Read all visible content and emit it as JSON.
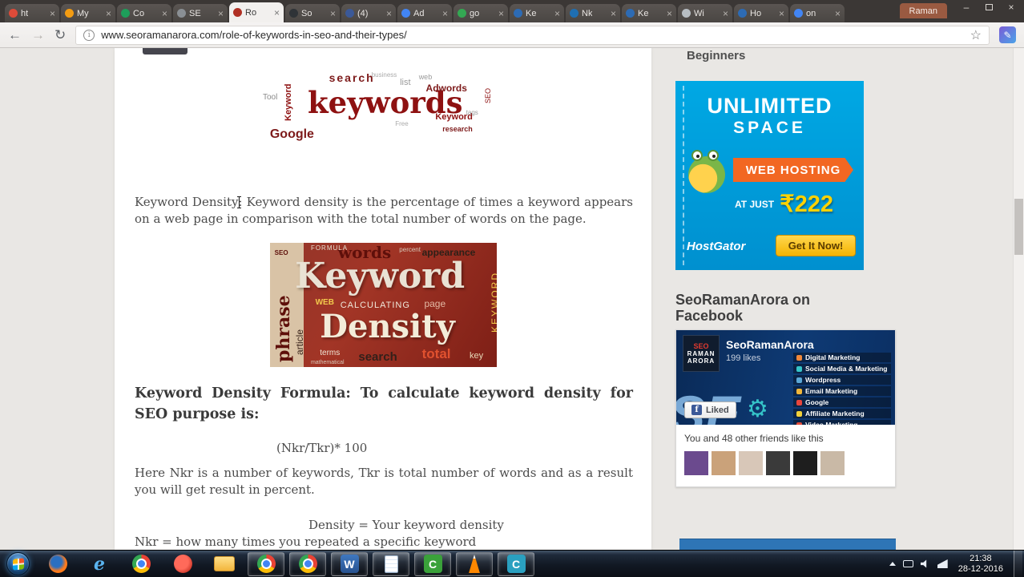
{
  "browser": {
    "tabs": [
      {
        "label": "ht",
        "fav": "#dd4b39"
      },
      {
        "label": "My",
        "fav": "#f39c12"
      },
      {
        "label": "Co",
        "fav": "#1e9e5a"
      },
      {
        "label": "SE",
        "fav": "#8a8f94"
      },
      {
        "label": "Ro",
        "fav": "#b03024",
        "cls": "active"
      },
      {
        "label": "So",
        "fav": "#2f3337"
      },
      {
        "label": "(4)",
        "fav": "#3b5998"
      },
      {
        "label": "Ad",
        "fav": "#4285f4"
      },
      {
        "label": "go",
        "fav": "#34a853"
      },
      {
        "label": "Ke",
        "fav": "#2d6bb4"
      },
      {
        "label": "Nk",
        "fav": "#1f6fb2"
      },
      {
        "label": "Ke",
        "fav": "#2d6bb4"
      },
      {
        "label": "Wi",
        "fav": "#b7bdc2"
      },
      {
        "label": "Ho",
        "fav": "#2d6bb4"
      },
      {
        "label": "on",
        "fav": "#4285f4"
      }
    ],
    "tab_close": "×",
    "profile_name": "Raman",
    "controls": {
      "minimize": "–",
      "close": "×"
    },
    "nav": {
      "back": "←",
      "forward": "→",
      "reload": "↻"
    },
    "info_glyph": "i",
    "url": "www.seoramanarora.com/role-of-keywords-in-seo-and-their-types/",
    "star_glyph": "☆",
    "extension_glyph": "✎"
  },
  "article": {
    "p1_label": "Keyword Density:",
    "p1_text": " Keyword density is the percentage of times a keyword appears on a web page in comparison with the total number of words on the page.",
    "formula_heading": "Keyword Density Formula:  To calculate keyword density for SEO purpose is:",
    "formula": "(Nkr/Tkr)* 100",
    "p2": "Here Nkr is a number of keywords, Tkr is total number of words and as a result you will get result in percent.",
    "line_density": "Density = Your keyword density",
    "line_nkr": "Nkr = how many times you repeated a specific keyword"
  },
  "cloud1": {
    "words": [
      {
        "t": "search",
        "cls": "a1"
      },
      {
        "t": "keywords",
        "cls": "a2"
      },
      {
        "t": "Google",
        "cls": "a3"
      },
      {
        "t": "Keyword",
        "cls": "a4"
      },
      {
        "t": "Tool",
        "cls": "a5"
      },
      {
        "t": "list",
        "cls": "a6"
      },
      {
        "t": "business",
        "cls": "a7"
      },
      {
        "t": "Adwords",
        "cls": "a8"
      },
      {
        "t": "web",
        "cls": "a9"
      },
      {
        "t": "Keyword",
        "cls": "a10"
      },
      {
        "t": "Free",
        "cls": "a11"
      },
      {
        "t": "SEO",
        "cls": "a12"
      },
      {
        "t": "tags",
        "cls": "a13"
      },
      {
        "t": "research",
        "cls": "a14"
      }
    ]
  },
  "cloud2": {
    "words": [
      {
        "t": "FORMULA",
        "cls": "b1"
      },
      {
        "t": "words",
        "cls": "b2"
      },
      {
        "t": "percent",
        "cls": "b3"
      },
      {
        "t": "appearance",
        "cls": "b4"
      },
      {
        "t": "Keyword",
        "cls": "b5"
      },
      {
        "t": "WEB",
        "cls": "b6"
      },
      {
        "t": "CALCULATING",
        "cls": "b7"
      },
      {
        "t": "page",
        "cls": "b8"
      },
      {
        "t": "phrase",
        "cls": "b9"
      },
      {
        "t": "article",
        "cls": "b10"
      },
      {
        "t": "Density",
        "cls": "b11"
      },
      {
        "t": "terms",
        "cls": "b12"
      },
      {
        "t": "search",
        "cls": "b13"
      },
      {
        "t": "total",
        "cls": "b14"
      },
      {
        "t": "KEYWORD",
        "cls": "b15"
      },
      {
        "t": "key",
        "cls": "b16"
      },
      {
        "t": "SEO",
        "cls": "b17"
      },
      {
        "t": "mathematical",
        "cls": "b18"
      }
    ]
  },
  "sidebar": {
    "partial_heading": "Beginners",
    "ad": {
      "line1": "UNLIMITED",
      "line2": "SPACE",
      "ribbon": "WEB HOSTING",
      "at_just": "AT JUST",
      "price": "₹222",
      "brand": "HostGator",
      "cta": "Get It Now!"
    },
    "fb_heading": "SeoRamanArora on Facebook",
    "facebook": {
      "logo_lines": {
        "l1": "SEO",
        "l2": "RAMAN",
        "l3": "ARORA"
      },
      "name": "SeoRamanArora",
      "likes": "199 likes",
      "cover_text": "SE",
      "gear_glyph": "⚙",
      "items": [
        {
          "label": "Digital Marketing",
          "ic": "#f0883a"
        },
        {
          "label": "Social Media & Marketing",
          "ic": "#35c4c8"
        },
        {
          "label": "Wordpress",
          "ic": "#5aa7d6"
        },
        {
          "label": "Email Marketing",
          "ic": "#f0b63a"
        },
        {
          "label": "Google",
          "ic": "#e8453c"
        },
        {
          "label": "Affiliate Marketing",
          "ic": "#f2d13a"
        },
        {
          "label": "Video Marketing",
          "ic": "#e04b3a"
        }
      ],
      "liked_button": "Liked",
      "fb_glyph": "f",
      "caption": "You and 48 other friends like this",
      "avatars": [
        "#6b4a8e",
        "#caa27a",
        "#d8c7b8",
        "#3a3a3a",
        "#1e1e1e",
        "#c9b9a6"
      ]
    }
  },
  "taskbar": {
    "apps": [
      {
        "cls": "i-firefox"
      },
      {
        "cls": "i-ie",
        "glyph": "e"
      },
      {
        "cls": "i-chrome"
      },
      {
        "cls": "i-media"
      },
      {
        "cls": "i-folder"
      },
      {
        "cls": "i-chrome open"
      },
      {
        "cls": "i-chrome open"
      },
      {
        "cls": "i-word open",
        "glyph": "W"
      },
      {
        "cls": "i-notepad open"
      },
      {
        "cls": "i-devc open",
        "glyph": "C"
      },
      {
        "cls": "i-vlc open"
      },
      {
        "cls": "i-cpp open",
        "glyph": "C"
      }
    ],
    "time": "21:38",
    "date": "28-12-2016"
  }
}
